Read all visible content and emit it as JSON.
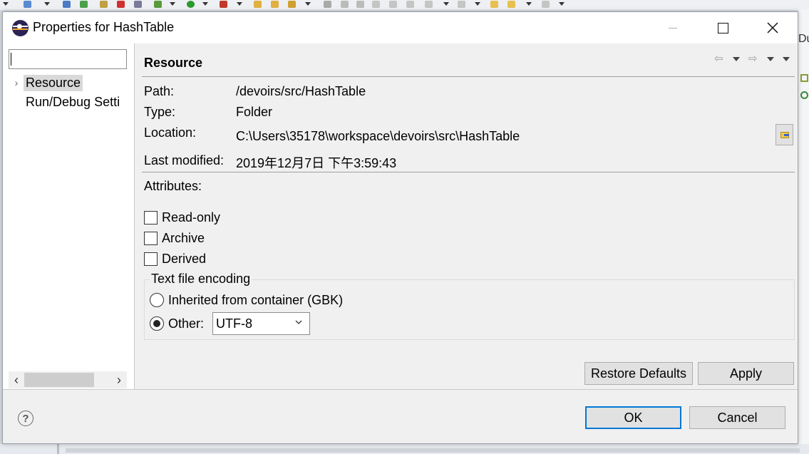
{
  "dialog": {
    "title": "Properties for HashTable"
  },
  "filter": {
    "value": ""
  },
  "tree": {
    "items": [
      {
        "label": "Resource",
        "selected": true,
        "expandable": true
      },
      {
        "label": "Run/Debug Setti",
        "selected": false,
        "expandable": false
      }
    ]
  },
  "page": {
    "title": "Resource",
    "properties": {
      "path_label": "Path:",
      "path_value": "/devoirs/src/HashTable",
      "type_label": "Type:",
      "type_value": "Folder",
      "location_label": "Location:",
      "location_value": "C:\\Users\\35178\\workspace\\devoirs\\src\\HashTable",
      "modified_label": "Last modified:",
      "modified_value": "2019年12月7日 下午3:59:43"
    },
    "attributes": {
      "label": "Attributes:",
      "items": [
        {
          "label": "Read-only",
          "checked": false
        },
        {
          "label": "Archive",
          "checked": false
        },
        {
          "label": "Derived",
          "checked": false
        }
      ]
    },
    "encoding": {
      "title": "Text file encoding",
      "inherited_label": "Inherited from container (GBK)",
      "other_label": "Other:",
      "selected_option": "other",
      "other_value": "UTF-8"
    },
    "buttons": {
      "restore_defaults": "Restore Defaults",
      "apply": "Apply"
    }
  },
  "footer": {
    "ok": "OK",
    "cancel": "Cancel",
    "help_symbol": "?"
  },
  "background": {
    "right_edge_text": "Du"
  }
}
